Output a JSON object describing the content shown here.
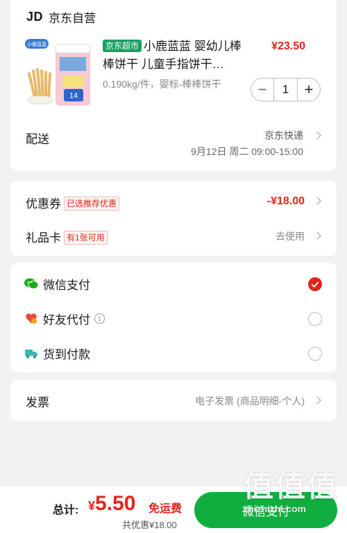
{
  "shop": {
    "logo": "JD",
    "name": "京东自营"
  },
  "product": {
    "market_tag": "京东超市",
    "title": "小鹿蓝蓝 婴幼儿棒棒饼干 儿童手指饼干…",
    "price": "¥23.50",
    "spec": "0.190kg/件，婴标-棒棒饼干",
    "quantity": "1",
    "image_brand": "小鹿蓝蓝",
    "image_price": "14"
  },
  "delivery": {
    "label": "配送",
    "method": "京东快递",
    "time": "9月12日 周二 09:00-15:00"
  },
  "coupon": {
    "label": "优惠券",
    "tag": "已选推荐优惠",
    "value": "-¥18.00"
  },
  "giftcard": {
    "label": "礼品卡",
    "tag": "有1张可用",
    "action": "去使用"
  },
  "payment": {
    "wechat": "微信支付",
    "friend": "好友代付",
    "friend_info": "i",
    "cod": "货到付款",
    "selected": "wechat"
  },
  "invoice": {
    "label": "发票",
    "value": "电子发票 (商品明细-个人)"
  },
  "footer": {
    "total_label": "总计:",
    "yen": "¥",
    "total": "5.50",
    "free_shipping": "免运费",
    "saved": "共优惠¥18.00",
    "pay_button": "微信支付"
  },
  "watermark": {
    "big": "值值值",
    "small": "zhizhizhi.com"
  },
  "colors": {
    "accent_red": "#e1251b",
    "wechat_green": "#10ad3f",
    "market_green": "#1aa061"
  }
}
